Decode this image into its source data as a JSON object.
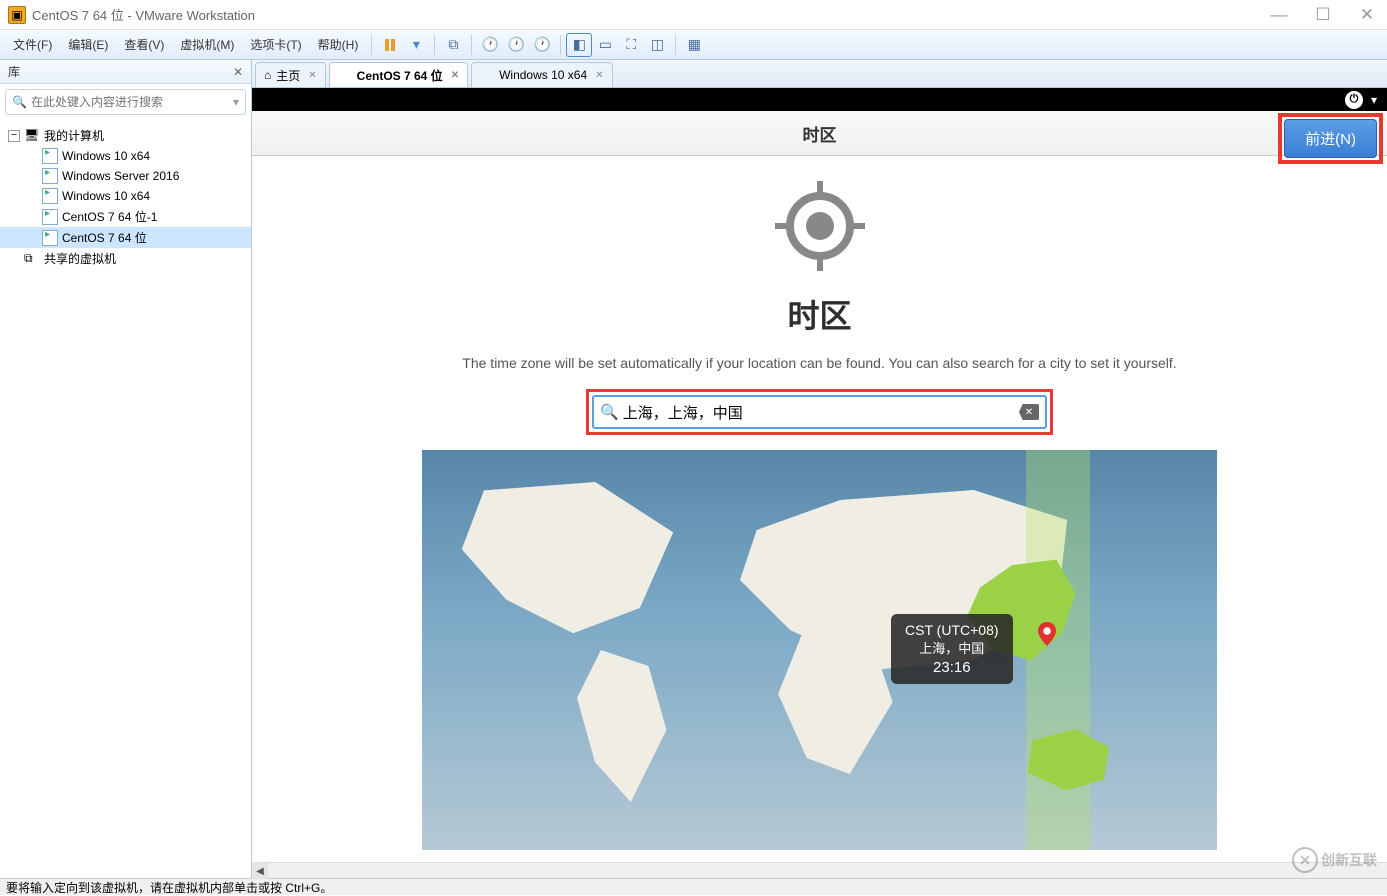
{
  "window": {
    "title": "CentOS 7 64 位 - VMware Workstation"
  },
  "menu": {
    "file": "文件(F)",
    "edit": "编辑(E)",
    "view": "查看(V)",
    "vm": "虚拟机(M)",
    "tabs": "选项卡(T)",
    "help": "帮助(H)"
  },
  "sidebar": {
    "title": "库",
    "search_placeholder": "在此处键入内容进行搜索",
    "root": "我的计算机",
    "items": [
      {
        "label": "Windows 10 x64"
      },
      {
        "label": "Windows Server 2016"
      },
      {
        "label": "Windows 10 x64"
      },
      {
        "label": "CentOS 7 64 位-1"
      },
      {
        "label": "CentOS 7 64 位"
      }
    ],
    "shared": "共享的虚拟机"
  },
  "tabs": [
    {
      "label": "主页",
      "icon": "home"
    },
    {
      "label": "CentOS 7 64 位",
      "icon": "vm",
      "active": true
    },
    {
      "label": "Windows 10 x64",
      "icon": "vm"
    }
  ],
  "gnome": {
    "header_title": "时区",
    "next_button": "前进(N)",
    "heading": "时区",
    "subtitle": "The time zone will be set automatically if your location can be found. You can also search for a city to set it yourself.",
    "search_value": "上海，上海，中国",
    "tooltip": {
      "tz": "CST (UTC+08)",
      "loc": "上海，中国",
      "time": "23:16"
    }
  },
  "statusbar": {
    "text": "要将输入定向到该虚拟机，请在虚拟机内部单击或按 Ctrl+G。"
  },
  "watermark": "创新互联"
}
